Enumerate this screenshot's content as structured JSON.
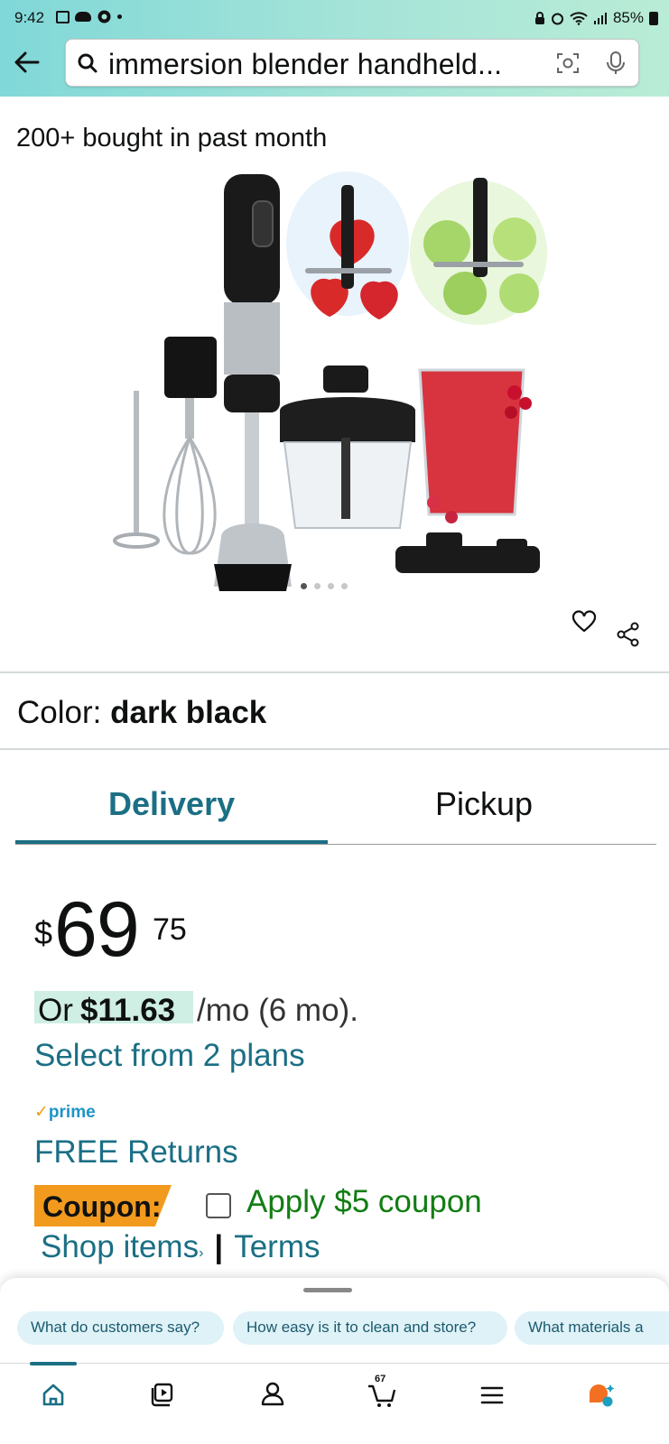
{
  "status_bar": {
    "time": "9:42",
    "battery": "85%"
  },
  "search": {
    "query": "immersion blender handheld..."
  },
  "product": {
    "bought_text": "200+ bought in past month",
    "color_label": "Color:",
    "color_value": "dark black",
    "image_count": 4,
    "active_image": 1
  },
  "tabs": {
    "delivery": "Delivery",
    "pickup": "Pickup",
    "selected": "Delivery"
  },
  "price": {
    "currency": "$",
    "whole": "69",
    "fraction": "75",
    "monthly_or": "Or",
    "monthly_amount": "$11.63",
    "monthly_term": "/mo (6 mo).",
    "plans_link": "Select from 2 plans"
  },
  "prime": {
    "label": "prime",
    "check": "✓"
  },
  "returns": "FREE Returns",
  "coupon": {
    "badge": "Coupon:",
    "apply": "Apply $5 coupon",
    "checked": false,
    "shop_items": "Shop items",
    "caret": "›",
    "separator": "|",
    "terms": "Terms"
  },
  "questions": [
    "What do customers say?",
    "How easy is it to clean and store?",
    "What materials a"
  ],
  "bottom_nav": {
    "cart_count": "67",
    "active": "home"
  },
  "colors": {
    "teal": "#1b6f84",
    "green": "#127d13",
    "coupon_orange": "#f29a1e"
  }
}
